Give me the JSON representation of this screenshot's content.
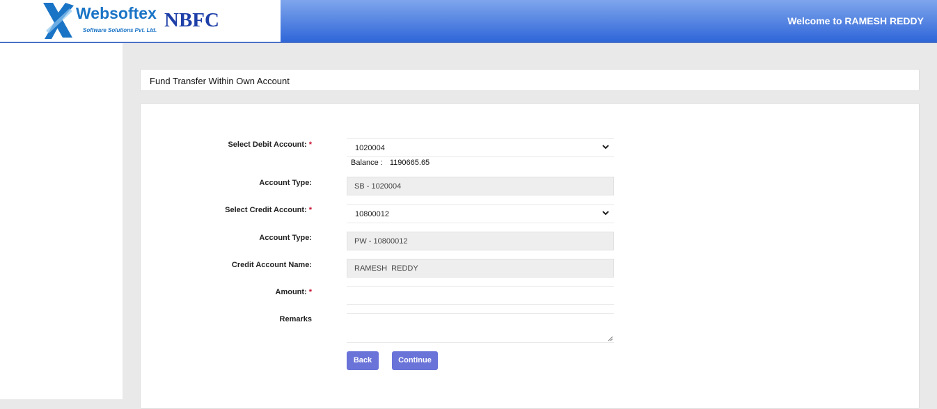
{
  "header": {
    "brand": "Websoftex",
    "brand_sub": "Software Solutions Pvt. Ltd.",
    "product": "NBFC",
    "welcome": "Welcome to RAMESH REDDY"
  },
  "page": {
    "title": "Fund Transfer Within Own Account"
  },
  "form": {
    "debit_account": {
      "label": "Select Debit Account:",
      "required": "*",
      "value": "1020004"
    },
    "balance": {
      "label": "Balance :",
      "value": "1190665.65"
    },
    "debit_type": {
      "label": "Account Type:",
      "value": "SB - 1020004"
    },
    "credit_account": {
      "label": "Select Credit Account:",
      "required": "*",
      "value": "10800012"
    },
    "credit_type": {
      "label": "Account Type:",
      "value": "PW - 10800012"
    },
    "credit_name": {
      "label": "Credit Account Name:",
      "value": "RAMESH  REDDY"
    },
    "amount": {
      "label": "Amount:",
      "required": "*",
      "value": ""
    },
    "remarks": {
      "label": "Remarks",
      "value": ""
    }
  },
  "buttons": {
    "back": "Back",
    "continue": "Continue"
  },
  "icons": {
    "dropdown": "chevron-down-icon",
    "logo": "websoftex-x-logo-icon",
    "resize": "resize-handle-icon"
  },
  "colors": {
    "header_start": "#7fa6ec",
    "header_end": "#2f66d8",
    "button": "#6a73d8",
    "required": "#c8102e"
  }
}
